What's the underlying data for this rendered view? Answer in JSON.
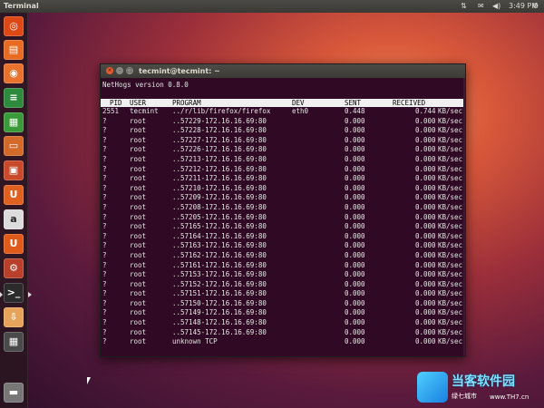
{
  "topbar": {
    "app_title": "Terminal",
    "clock": "3:49 PM",
    "icons": [
      "network-icon",
      "mail-icon",
      "volume-icon",
      "gear-icon"
    ]
  },
  "launcher": {
    "items": [
      {
        "name": "dash-home-icon",
        "color": "#dd4814",
        "glyph": "◎"
      },
      {
        "name": "files-icon",
        "color": "#e86b23",
        "glyph": "▤"
      },
      {
        "name": "firefox-icon",
        "color": "#e8722e",
        "glyph": "◉"
      },
      {
        "name": "writer-icon",
        "color": "#2e8b3d",
        "glyph": "≡"
      },
      {
        "name": "calc-icon",
        "color": "#3a9a3a",
        "glyph": "▦"
      },
      {
        "name": "impress-icon",
        "color": "#d36a2a",
        "glyph": "▭"
      },
      {
        "name": "software-center-icon",
        "color": "#c84a2a",
        "glyph": "▣"
      },
      {
        "name": "ubuntu-one-icon",
        "color": "#e06020",
        "glyph": "U"
      },
      {
        "name": "amazon-icon",
        "color": "#dcdcdc",
        "glyph": "a"
      },
      {
        "name": "ubuntu-one-music-icon",
        "color": "#e05a1a",
        "glyph": "U"
      },
      {
        "name": "settings-icon",
        "color": "#b8402a",
        "glyph": "⚙"
      },
      {
        "name": "terminal-icon",
        "color": "#2b2b2b",
        "glyph": ">_"
      },
      {
        "name": "updates-icon",
        "color": "#e6a35a",
        "glyph": "⇩"
      },
      {
        "name": "workspaces-icon",
        "color": "#4a4a4a",
        "glyph": "▦"
      },
      {
        "name": "trash-icon",
        "color": "#777777",
        "glyph": "▬"
      }
    ]
  },
  "window": {
    "title": "tecmint@tecmint: ~"
  },
  "nethogs": {
    "version_line": "NetHogs version 0.8.0",
    "columns": [
      "PID",
      "USER",
      "PROGRAM",
      "DEV",
      "SENT",
      "RECEIVED"
    ],
    "rows": [
      {
        "pid": "2551",
        "user": "tecmint",
        "program": "../r/lib/firefox/firefox",
        "dev": "eth0",
        "sent": "0.448",
        "received": "0.744",
        "unit": "KB/sec"
      },
      {
        "pid": "?",
        "user": "root",
        "program": "..57229-172.16.16.69:80",
        "dev": "",
        "sent": "0.000",
        "received": "0.000",
        "unit": "KB/sec"
      },
      {
        "pid": "?",
        "user": "root",
        "program": "..57228-172.16.16.69:80",
        "dev": "",
        "sent": "0.000",
        "received": "0.000",
        "unit": "KB/sec"
      },
      {
        "pid": "?",
        "user": "root",
        "program": "..57227-172.16.16.69:80",
        "dev": "",
        "sent": "0.000",
        "received": "0.000",
        "unit": "KB/sec"
      },
      {
        "pid": "?",
        "user": "root",
        "program": "..57226-172.16.16.69:80",
        "dev": "",
        "sent": "0.000",
        "received": "0.000",
        "unit": "KB/sec"
      },
      {
        "pid": "?",
        "user": "root",
        "program": "..57213-172.16.16.69:80",
        "dev": "",
        "sent": "0.000",
        "received": "0.000",
        "unit": "KB/sec"
      },
      {
        "pid": "?",
        "user": "root",
        "program": "..57212-172.16.16.69:80",
        "dev": "",
        "sent": "0.000",
        "received": "0.000",
        "unit": "KB/sec"
      },
      {
        "pid": "?",
        "user": "root",
        "program": "..57211-172.16.16.69:80",
        "dev": "",
        "sent": "0.000",
        "received": "0.000",
        "unit": "KB/sec"
      },
      {
        "pid": "?",
        "user": "root",
        "program": "..57210-172.16.16.69:80",
        "dev": "",
        "sent": "0.000",
        "received": "0.000",
        "unit": "KB/sec"
      },
      {
        "pid": "?",
        "user": "root",
        "program": "..57209-172.16.16.69:80",
        "dev": "",
        "sent": "0.000",
        "received": "0.000",
        "unit": "KB/sec"
      },
      {
        "pid": "?",
        "user": "root",
        "program": "..57208-172.16.16.69:80",
        "dev": "",
        "sent": "0.000",
        "received": "0.000",
        "unit": "KB/sec"
      },
      {
        "pid": "?",
        "user": "root",
        "program": "..57205-172.16.16.69:80",
        "dev": "",
        "sent": "0.000",
        "received": "0.000",
        "unit": "KB/sec"
      },
      {
        "pid": "?",
        "user": "root",
        "program": "..57165-172.16.16.69:80",
        "dev": "",
        "sent": "0.000",
        "received": "0.000",
        "unit": "KB/sec"
      },
      {
        "pid": "?",
        "user": "root",
        "program": "..57164-172.16.16.69:80",
        "dev": "",
        "sent": "0.000",
        "received": "0.000",
        "unit": "KB/sec"
      },
      {
        "pid": "?",
        "user": "root",
        "program": "..57163-172.16.16.69:80",
        "dev": "",
        "sent": "0.000",
        "received": "0.000",
        "unit": "KB/sec"
      },
      {
        "pid": "?",
        "user": "root",
        "program": "..57162-172.16.16.69:80",
        "dev": "",
        "sent": "0.000",
        "received": "0.000",
        "unit": "KB/sec"
      },
      {
        "pid": "?",
        "user": "root",
        "program": "..57161-172.16.16.69:80",
        "dev": "",
        "sent": "0.000",
        "received": "0.000",
        "unit": "KB/sec"
      },
      {
        "pid": "?",
        "user": "root",
        "program": "..57153-172.16.16.69:80",
        "dev": "",
        "sent": "0.000",
        "received": "0.000",
        "unit": "KB/sec"
      },
      {
        "pid": "?",
        "user": "root",
        "program": "..57152-172.16.16.69:80",
        "dev": "",
        "sent": "0.000",
        "received": "0.000",
        "unit": "KB/sec"
      },
      {
        "pid": "?",
        "user": "root",
        "program": "..57151-172.16.16.69:80",
        "dev": "",
        "sent": "0.000",
        "received": "0.000",
        "unit": "KB/sec"
      },
      {
        "pid": "?",
        "user": "root",
        "program": "..57150-172.16.16.69:80",
        "dev": "",
        "sent": "0.000",
        "received": "0.000",
        "unit": "KB/sec"
      },
      {
        "pid": "?",
        "user": "root",
        "program": "..57149-172.16.16.69:80",
        "dev": "",
        "sent": "0.000",
        "received": "0.000",
        "unit": "KB/sec"
      },
      {
        "pid": "?",
        "user": "root",
        "program": "..57148-172.16.16.69:80",
        "dev": "",
        "sent": "0.000",
        "received": "0.000",
        "unit": "KB/sec"
      },
      {
        "pid": "?",
        "user": "root",
        "program": "..57145-172.16.16.69:80",
        "dev": "",
        "sent": "0.000",
        "received": "0.000",
        "unit": "KB/sec"
      },
      {
        "pid": "?",
        "user": "root",
        "program": "unknown TCP",
        "dev": "",
        "sent": "0.000",
        "received": "0.000",
        "unit": "KB/sec"
      }
    ]
  },
  "watermark": {
    "brand": "当客软件园",
    "site": "绿七城市",
    "url": "www.TH7.cn"
  }
}
